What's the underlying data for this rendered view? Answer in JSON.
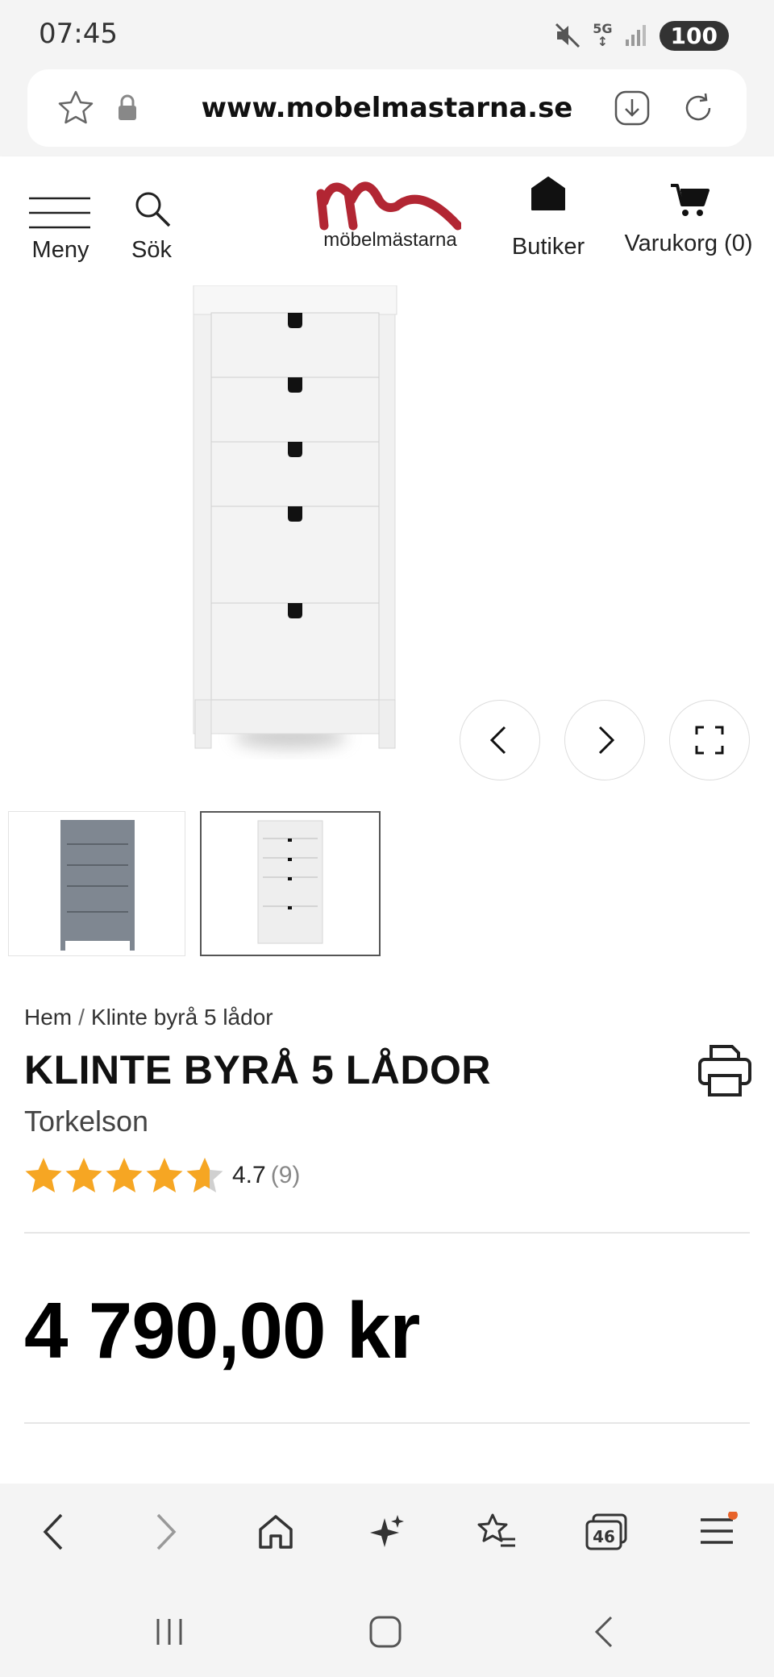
{
  "status_bar": {
    "time": "07:45",
    "network": "5G",
    "battery": "100",
    "icons": [
      "mute-icon",
      "signal-icon",
      "battery-icon"
    ]
  },
  "browser": {
    "url": "www.mobelmastarna.se",
    "icons": [
      "star-icon",
      "lock-icon",
      "download-icon",
      "reload-icon"
    ]
  },
  "header": {
    "menu_label": "Meny",
    "search_label": "Sök",
    "logo_text": "möbelmästarna",
    "stores_label": "Butiker",
    "cart_label": "Varukorg (0)"
  },
  "gallery": {
    "thumb_count": 2,
    "selected_thumb": 2,
    "controls": [
      "chevron-left-icon",
      "chevron-right-icon",
      "fullscreen-icon"
    ]
  },
  "breadcrumb": {
    "home": "Hem",
    "separator": "/",
    "current": "Klinte byrå 5 lådor"
  },
  "product": {
    "title": "KLINTE BYRÅ 5 LÅDOR",
    "brand": "Torkelson",
    "rating": "4.7",
    "rating_value": 4.7,
    "rating_count": "(9)",
    "price": "4 790,00 kr"
  },
  "bottom_bar": {
    "tabs_count": "46",
    "icons": [
      "back-icon",
      "forward-icon",
      "home-icon",
      "sparkle-icon",
      "bookmarks-icon",
      "tabs-icon",
      "menu-icon"
    ]
  },
  "colors": {
    "logo_red": "#b22633",
    "star_orange": "#f6a623",
    "notification_dot": "#e8632a"
  }
}
